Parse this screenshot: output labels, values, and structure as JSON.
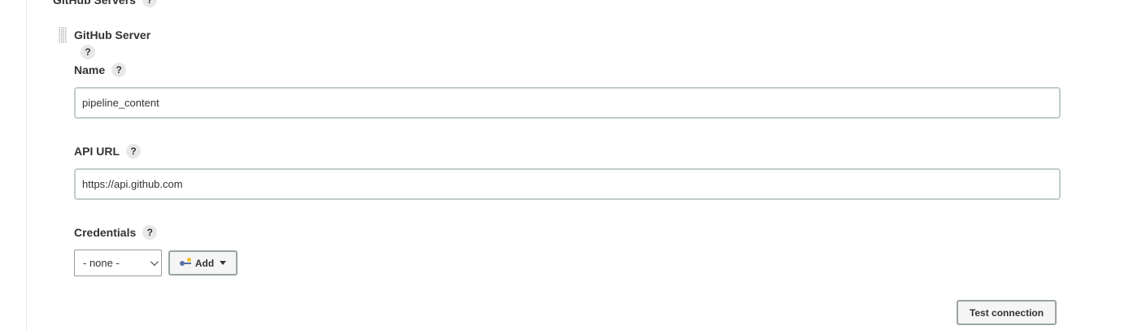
{
  "section": {
    "title": "GitHub Servers",
    "help_label": "?"
  },
  "server": {
    "title": "GitHub Server",
    "help_label": "?"
  },
  "fields": {
    "name": {
      "label": "Name",
      "help_label": "?",
      "value": "pipeline_content"
    },
    "api_url": {
      "label": "API URL",
      "help_label": "?",
      "value": "https://api.github.com"
    },
    "credentials": {
      "label": "Credentials",
      "help_label": "?",
      "selected": "- none -",
      "add_label": "Add"
    }
  },
  "actions": {
    "test_connection_label": "Test connection"
  },
  "icons": {
    "drag": "drag-handle-icon",
    "help": "help-icon",
    "key": "key-icon",
    "caret": "caret-down-icon",
    "chevron": "chevron-down-icon"
  },
  "colors": {
    "input_border": "#c3cccc",
    "button_border": "#9aa3a3",
    "button_bg": "#f5f5f5",
    "help_bg": "#e8e8e8"
  }
}
